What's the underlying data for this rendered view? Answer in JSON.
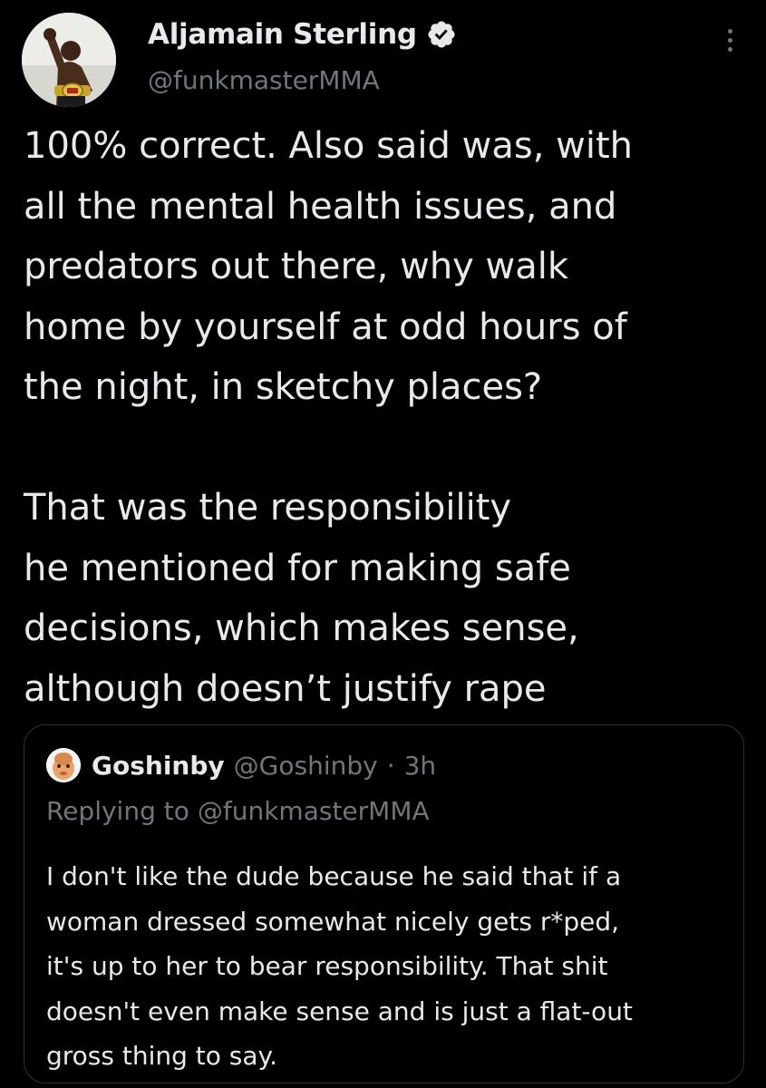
{
  "author": {
    "name": "Aljamain Sterling",
    "handle": "@funkmasterMMA",
    "verified": true,
    "avatar": "avatar-fighter-with-belt"
  },
  "tweet": {
    "paragraphs": [
      [
        "100% correct. Also said was, with",
        "all the mental health issues, and",
        "predators out there, why walk",
        "home by yourself at odd hours of",
        "the night, in sketchy places?"
      ],
      [
        "That was the responsibility",
        "he mentioned for making safe",
        "decisions, which makes sense,",
        "although doesn’t justify rape"
      ]
    ]
  },
  "quoted": {
    "name": "Goshinby",
    "handle": "@Goshinby",
    "separator": "·",
    "time": "3h",
    "replying_prefix": "Replying to",
    "replying_to": "@funkmasterMMA",
    "lines": [
      "I don't like the dude because he said that if a",
      "woman dressed somewhat nicely gets r*ped,",
      "it's up to her to bear responsibility. That shit",
      "doesn't even make sense and is just a flat-out",
      "gross thing to say."
    ]
  },
  "icons": {
    "verified": "verified-badge-icon",
    "more": "more-options-icon"
  },
  "colors": {
    "background": "#000000",
    "text": "#e7e9ea",
    "secondary": "#71767b",
    "border": "#2f3336"
  }
}
